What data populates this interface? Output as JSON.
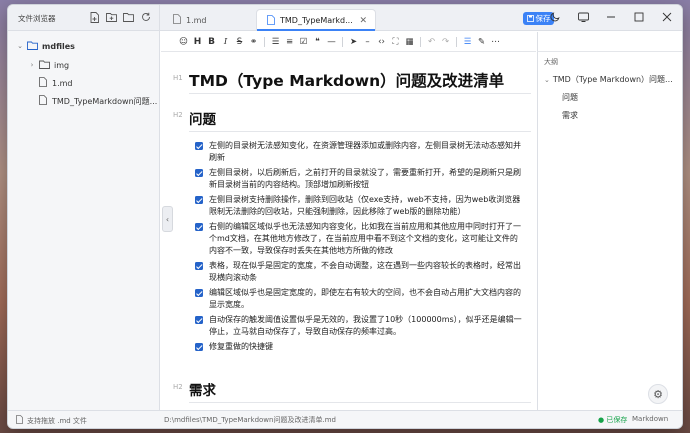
{
  "sidebar": {
    "title": "文件浏览器",
    "tree": [
      {
        "label": "mdfiles",
        "level": 0,
        "expanded": true,
        "type": "folder"
      },
      {
        "label": "img",
        "level": 1,
        "expanded": false,
        "type": "folder"
      },
      {
        "label": "1.md",
        "level": 1,
        "type": "file"
      },
      {
        "label": "TMD_TypeMarkdown问题...",
        "level": 1,
        "type": "file"
      }
    ]
  },
  "tabs": [
    {
      "label": "1.md",
      "active": false
    },
    {
      "label": "TMD_TypeMarkd...",
      "active": true
    }
  ],
  "header": {
    "save_label": "保存"
  },
  "editor": {
    "h1": "TMD（Type Markdown）问题及改进清单",
    "h1_mark": "H1",
    "h2_mark": "H2",
    "section1": "问题",
    "tasks": [
      "左侧的目录树无法感知变化，在资源管理器添加或删除内容，左侧目录树无法动态感知并刷新",
      "左侧目录树，以后刷新后，之前打开的目录就没了，需要重新打开，希望的是刷新只是刷新目录树当前的内容结构。顶部增加刷新按钮",
      "左侧目录树支持删除操作，删除到回收站（仅exe支持，web不支持，因为web收浏览器限制无法删除的回收站，只能强制删除，因此移除了web版的删除功能）",
      "右侧的编辑区域似乎也无法感知内容变化，比如我在当前应用和其他应用中同时打开了一个md文档，在其他地方修改了，在当前应用中看不到这个文档的变化，这可能让文件的内容不一致，导致保存时丢失在其他地方所做的修改",
      "表格，现在似乎是固定的宽度，不会自动调整，这在遇到一些内容较长的表格时，经常出现横向滚动条",
      "编辑区域似乎也是固定宽度的，即使左右有较大的空间，也不会自动占用扩大文档内容的显示宽度。",
      "自动保存的触发阈值设置似乎是无效的，我设置了10秒（100000ms），似乎还是编辑一停止，立马就自动保存了，导致自动保存的频率过高。",
      "修复重做的快捷键"
    ],
    "section2": "需求"
  },
  "outline": {
    "title": "大纲",
    "items": [
      {
        "label": "TMD（Type Markdown）问题...",
        "level": 1
      },
      {
        "label": "问题",
        "level": 2
      },
      {
        "label": "需求",
        "level": 2
      }
    ]
  },
  "statusbar": {
    "hint": "支持拖放 .md 文件",
    "path": "D:\\mdfiles\\TMD_TypeMarkdown问题及改进清单.md",
    "saved": "● 已保存",
    "mode": "Markdown"
  },
  "colors": {
    "accent": "#3b82f6",
    "checkbox": "#2563c9",
    "saved": "#16a34a"
  }
}
